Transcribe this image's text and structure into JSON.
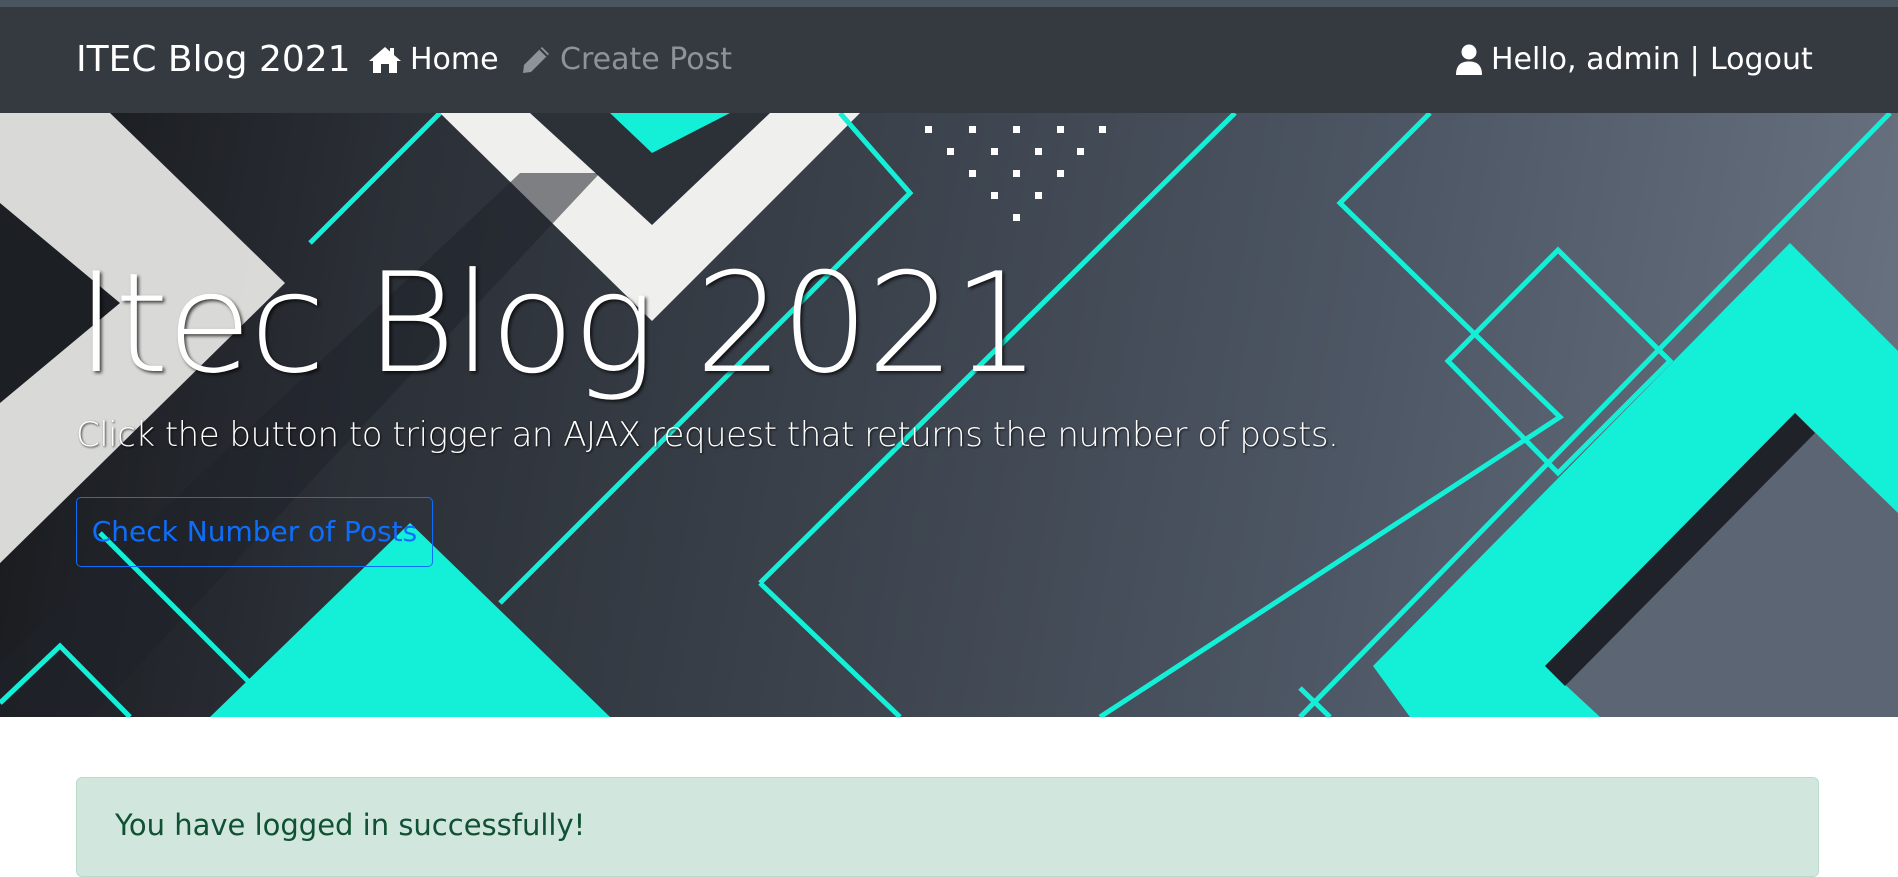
{
  "navbar": {
    "brand": "ITEC Blog 2021",
    "home_label": "Home",
    "create_post_label": "Create Post",
    "greeting": "Hello, admin |",
    "logout_label": "Logout",
    "icons": {
      "home": "home-icon",
      "create_post": "pencil-icon",
      "user": "user-icon"
    }
  },
  "hero": {
    "title": "Itec Blog 2021",
    "lead": "Click the button to trigger an AJAX request that returns the number of posts.",
    "button_label": "Check Number of Posts"
  },
  "alert": {
    "message": "You have logged in successfully!"
  },
  "colors": {
    "navbar_bg": "#343a40",
    "accent_teal": "#14f0d8",
    "button_blue": "#0d6efd",
    "alert_bg": "#d1e7dd",
    "alert_text": "#0f5132"
  }
}
